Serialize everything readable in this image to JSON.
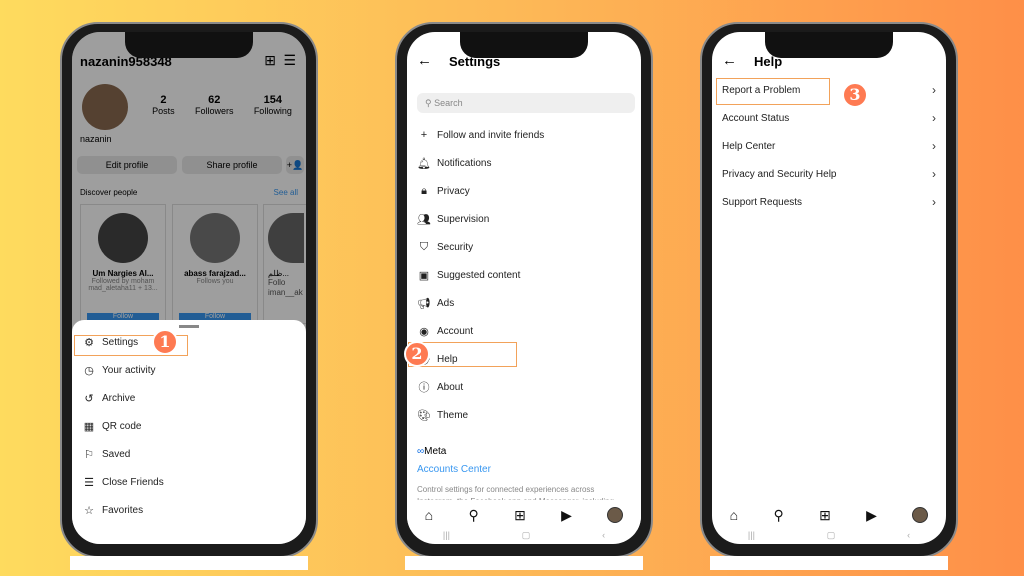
{
  "colors": {
    "accent": "#fe7a52",
    "link": "#3897f0",
    "highlight": "#f2a25a"
  },
  "phone1": {
    "username": "nazanin958348",
    "name": "nazanin",
    "stats": [
      {
        "value": "2",
        "label": "Posts"
      },
      {
        "value": "62",
        "label": "Followers"
      },
      {
        "value": "154",
        "label": "Following"
      }
    ],
    "edit_profile": "Edit profile",
    "share_profile": "Share profile",
    "discover": "Discover people",
    "see_all": "See all",
    "cards": [
      {
        "name": "Um Nargies Al...",
        "sub": "Followed by moham mad_aletaha11 + 13..."
      },
      {
        "name": "abass farajzad...",
        "sub": "Follows you"
      },
      {
        "name": "ظلم...",
        "sub": "Follo iman__ak"
      }
    ],
    "follow": "Follow",
    "menu": [
      {
        "icon": "gear-icon",
        "label": "Settings"
      },
      {
        "icon": "activity-icon",
        "label": "Your activity"
      },
      {
        "icon": "archive-icon",
        "label": "Archive"
      },
      {
        "icon": "qr-icon",
        "label": "QR code"
      },
      {
        "icon": "bookmark-icon",
        "label": "Saved"
      },
      {
        "icon": "list-icon",
        "label": "Close Friends"
      },
      {
        "icon": "star-icon",
        "label": "Favorites"
      }
    ],
    "step": "1"
  },
  "phone2": {
    "title": "Settings",
    "search_placeholder": "Search",
    "items": [
      {
        "icon": "add-person-icon",
        "label": "Follow and invite friends"
      },
      {
        "icon": "bell-icon",
        "label": "Notifications"
      },
      {
        "icon": "lock-icon",
        "label": "Privacy"
      },
      {
        "icon": "supervision-icon",
        "label": "Supervision"
      },
      {
        "icon": "shield-icon",
        "label": "Security"
      },
      {
        "icon": "suggested-icon",
        "label": "Suggested content"
      },
      {
        "icon": "megaphone-icon",
        "label": "Ads"
      },
      {
        "icon": "account-icon",
        "label": "Account"
      },
      {
        "icon": "help-icon",
        "label": "Help"
      },
      {
        "icon": "info-icon",
        "label": "About"
      },
      {
        "icon": "palette-icon",
        "label": "Theme"
      }
    ],
    "meta": "Meta",
    "accounts_center": "Accounts Center",
    "accounts_desc": "Control settings for connected experiences across Instagram, the Facebook app and Messenger, including",
    "step": "2"
  },
  "phone3": {
    "title": "Help",
    "items": [
      "Report a Problem",
      "Account Status",
      "Help Center",
      "Privacy and Security Help",
      "Support Requests"
    ],
    "step": "3"
  }
}
